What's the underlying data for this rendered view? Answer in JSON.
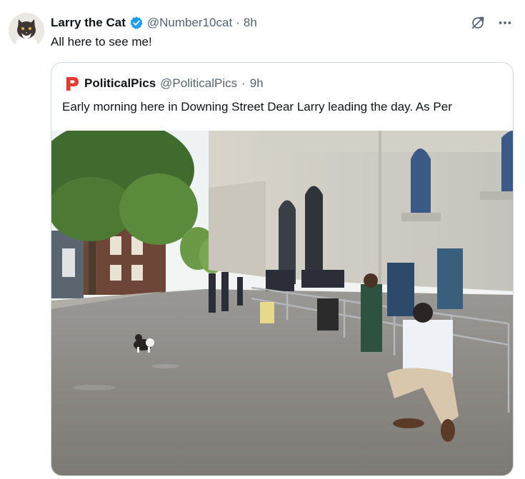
{
  "tweet": {
    "author_name": "Larry the Cat",
    "author_handle": "@Number10cat",
    "separator": "·",
    "time": "8h",
    "text": "All here to see me!",
    "verified_icon": "verified-badge-icon",
    "avatar_icon": "cat-avatar"
  },
  "top_actions": [
    {
      "icon": "grok-icon"
    },
    {
      "icon": "more-icon"
    }
  ],
  "quoted": {
    "author_name": "PoliticalPics",
    "author_handle": "@PoliticalPics",
    "separator": "·",
    "time": "9h",
    "text": "Early morning here in Downing Street Dear Larry leading the day. As Per",
    "logo_icon": "politicalpics-logo",
    "image": "downing-street-photo"
  },
  "colors": {
    "verified_blue": "#1d9bf0",
    "secondary_text": "#536471",
    "border": "#cfd9de",
    "logo_red": "#e8372c"
  }
}
